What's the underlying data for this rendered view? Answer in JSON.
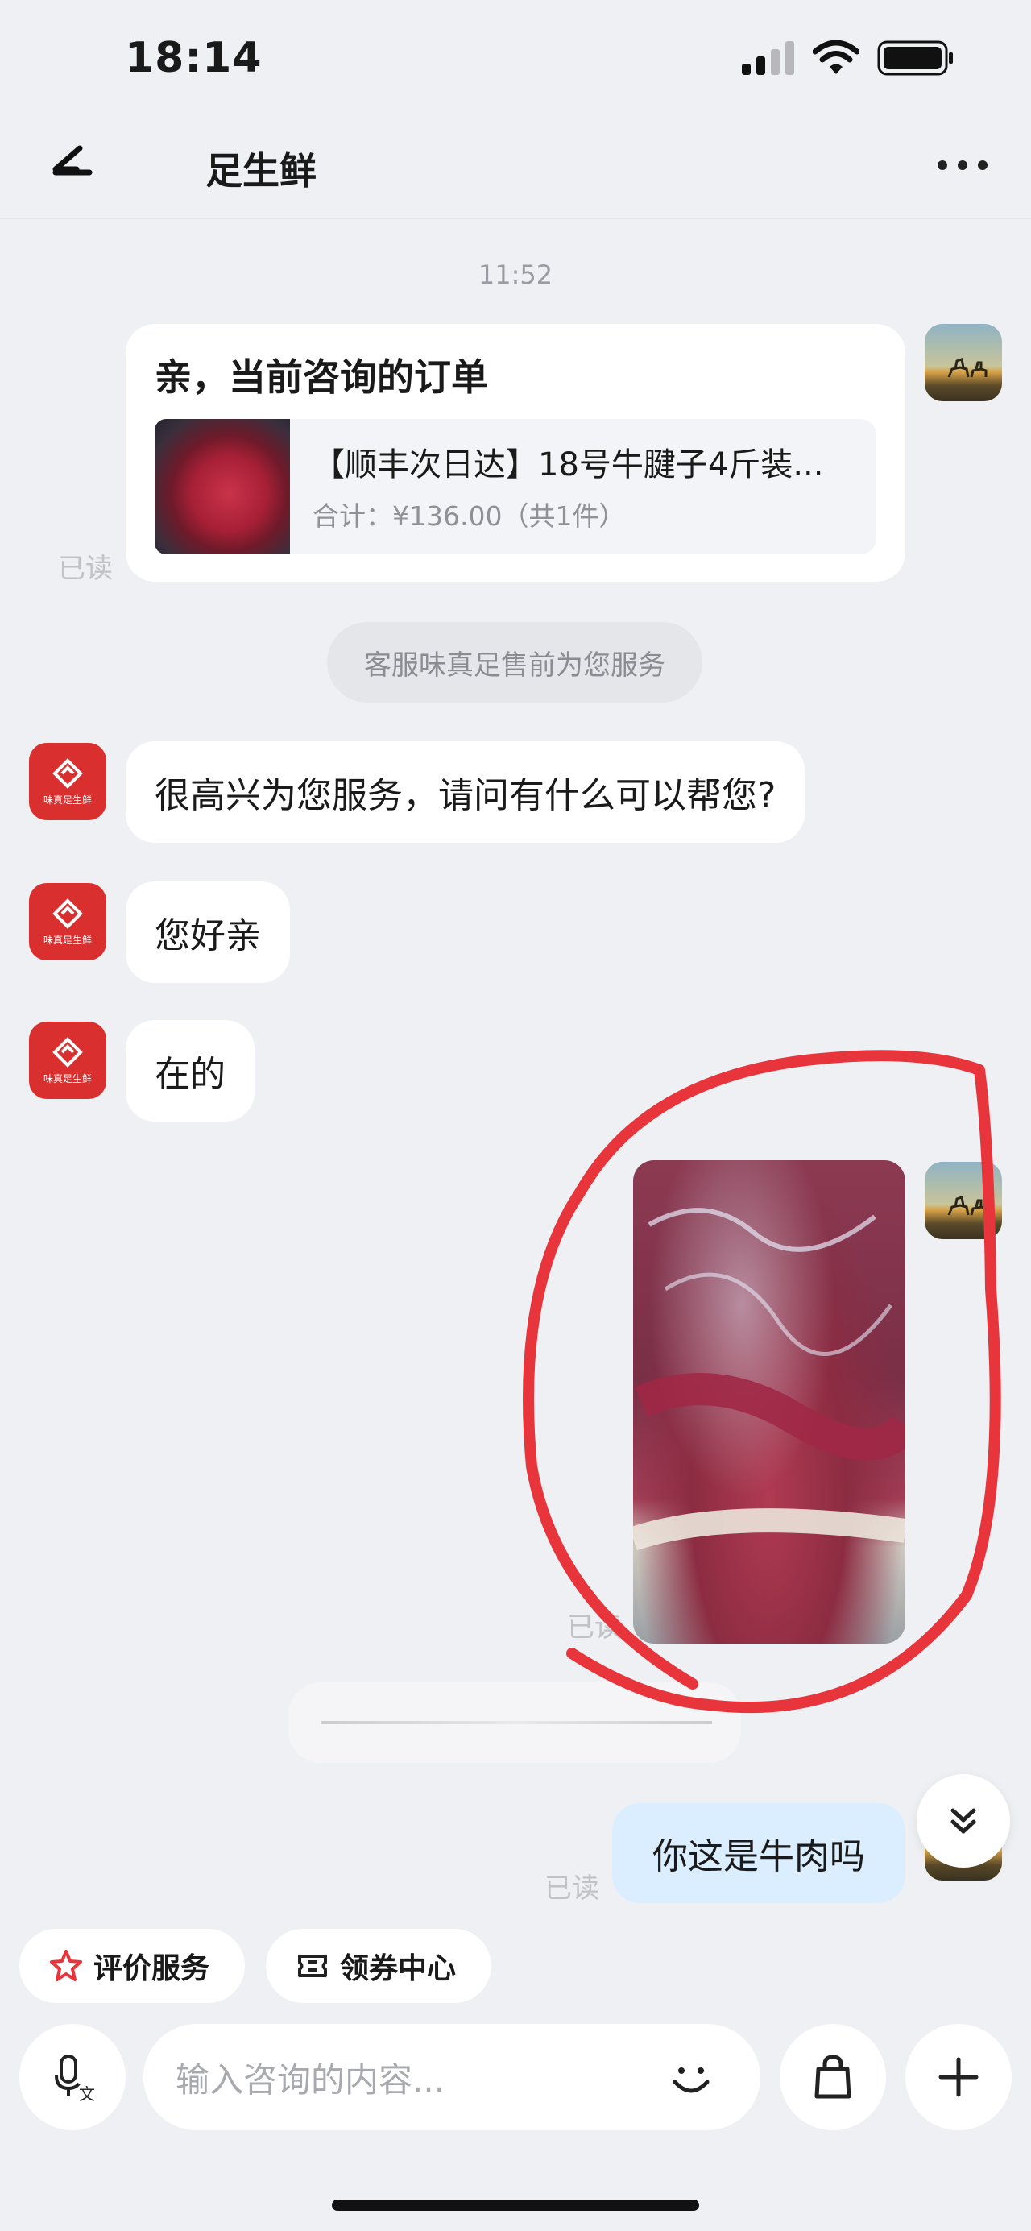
{
  "status": {
    "time": "18:14"
  },
  "nav": {
    "title": "‧足生鲜",
    "title_visible": "足生鲜"
  },
  "chat": {
    "timestamp": "11:52",
    "order_card": {
      "heading": "亲，当前咨询的订单",
      "product_title": "【顺丰次日达】18号牛腱子4斤装...",
      "total": "合计：¥136.00（共1件）"
    },
    "read_label": "已读",
    "service_notice": "客服味真足售前为您服务",
    "shop_avatar_text": "味真足生鲜",
    "messages": [
      {
        "from": "shop",
        "text": "很高兴为您服务，请问有什么可以帮您?"
      },
      {
        "from": "shop",
        "text": "您好亲"
      },
      {
        "from": "shop",
        "text": "在的"
      },
      {
        "from": "user",
        "text": "你这是牛肉吗"
      }
    ]
  },
  "quick_actions": {
    "rate": "评价服务",
    "coupons": "领券中心"
  },
  "composer": {
    "placeholder": "输入咨询的内容..."
  },
  "colors": {
    "background": "#eef0f4",
    "user_bubble": "#dbeeff",
    "shop_red": "#d9302f",
    "annotation_red": "#e8343b"
  }
}
